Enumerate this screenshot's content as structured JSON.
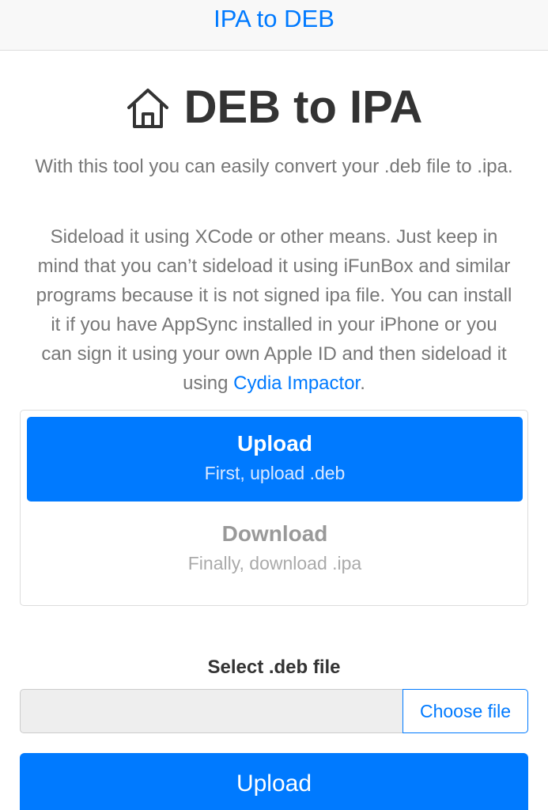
{
  "navbar": {
    "link": "IPA to DEB"
  },
  "header": {
    "icon": "home-icon",
    "title": "DEB to IPA"
  },
  "intro": "With this tool you can easily convert your .deb file to .ipa.",
  "description": {
    "text": "Sideload it using XCode or other means. Just keep in mind that you can’t sideload it using iFunBox and similar programs because it is not signed ipa file. You can install it if you have AppSync installed in your iPhone or you can sign it using your own Apple ID and then sideload it using ",
    "link": "Cydia Impactor",
    "suffix": "."
  },
  "steps": [
    {
      "title": "Upload",
      "subtitle": "First, upload .deb",
      "active": true
    },
    {
      "title": "Download",
      "subtitle": "Finally, download .ipa",
      "active": false
    }
  ],
  "form": {
    "label": "Select .deb file",
    "file_value": "",
    "choose_label": "Choose file",
    "submit_label": "Upload"
  },
  "colors": {
    "accent": "#007aff",
    "text": "#333333",
    "muted": "#777777"
  }
}
